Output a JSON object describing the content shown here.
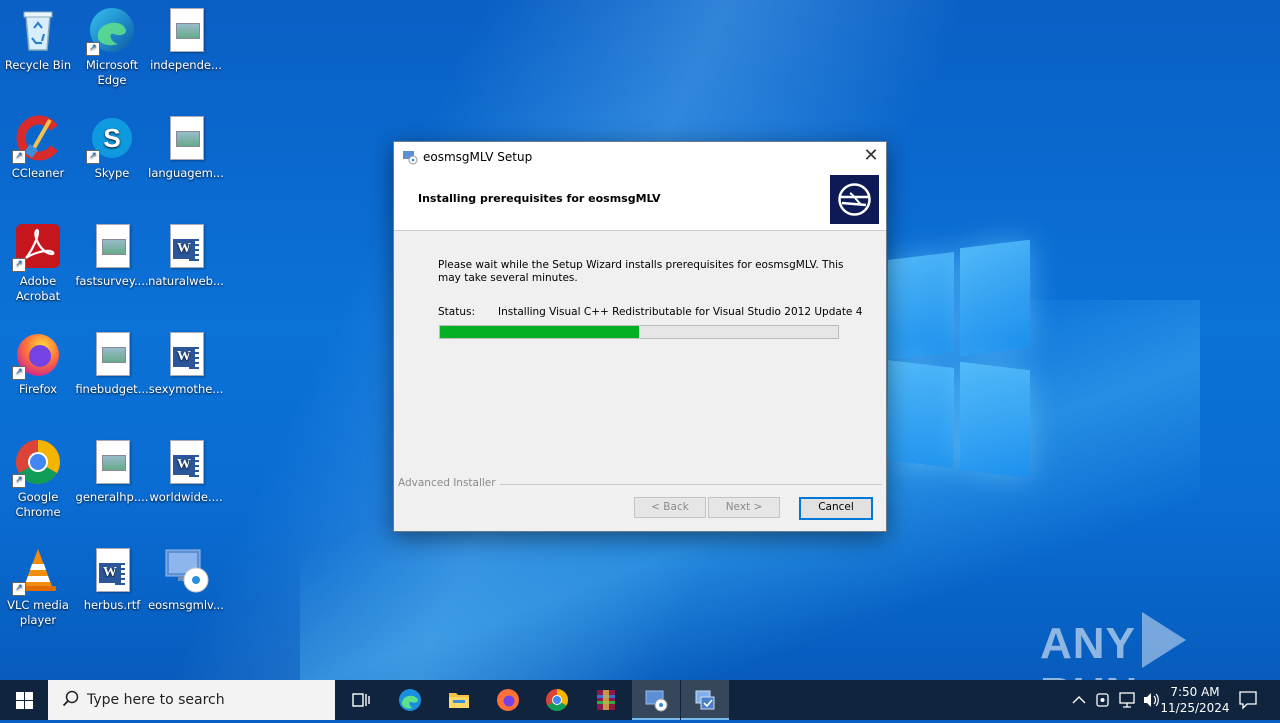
{
  "desktop": {
    "icons": [
      {
        "label": "Recycle Bin",
        "icon": "recycle-bin-icon"
      },
      {
        "label": "Microsoft Edge",
        "icon": "edge-icon"
      },
      {
        "label": "independe...",
        "icon": "image-file-icon"
      },
      {
        "label": "CCleaner",
        "icon": "ccleaner-icon"
      },
      {
        "label": "Skype",
        "icon": "skype-icon"
      },
      {
        "label": "languagem...",
        "icon": "image-file-icon"
      },
      {
        "label": "Adobe Acrobat",
        "icon": "acrobat-icon"
      },
      {
        "label": "fastsurvey....",
        "icon": "image-file-icon"
      },
      {
        "label": "naturalweb...",
        "icon": "word-doc-icon"
      },
      {
        "label": "Firefox",
        "icon": "firefox-icon"
      },
      {
        "label": "finebudget...",
        "icon": "image-file-icon"
      },
      {
        "label": "sexymothe...",
        "icon": "word-doc-icon"
      },
      {
        "label": "Google Chrome",
        "icon": "chrome-icon"
      },
      {
        "label": "generalhp....",
        "icon": "image-file-icon"
      },
      {
        "label": "worldwide....",
        "icon": "word-doc-icon"
      },
      {
        "label": "VLC media player",
        "icon": "vlc-icon"
      },
      {
        "label": "herbus.rtf",
        "icon": "word-doc-icon"
      },
      {
        "label": "eosmsgmlv...",
        "icon": "installer-icon"
      }
    ]
  },
  "dialog": {
    "title": "eosmsgMLV Setup",
    "header_title": "Installing prerequisites for eosmsgMLV",
    "body_text": "Please wait while the Setup Wizard installs prerequisites for eosmsgMLV.  This may take several minutes.",
    "status_label": "Status:",
    "status_value": "Installing Visual C++ Redistributable for Visual Studio 2012 Update 4",
    "progress": 0.5,
    "branding": "Advanced Installer",
    "back_label": "< Back",
    "next_label": "Next >",
    "cancel_label": "Cancel"
  },
  "watermark": {
    "left": "ANY",
    "right": "RUN"
  },
  "taskbar": {
    "search_placeholder": "Type here to search",
    "time": "7:50 AM",
    "date": "11/25/2024"
  }
}
